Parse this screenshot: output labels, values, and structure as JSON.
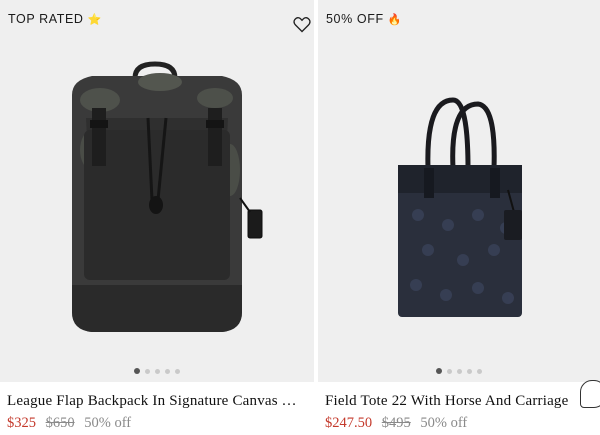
{
  "products": [
    {
      "badge": "TOP RATED",
      "badge_emoji": "⭐",
      "title": "League Flap Backpack In Signature Canvas Wi…",
      "price": "$325",
      "original_price": "$650",
      "discount": "50% off",
      "image_dots": 5,
      "active_dot": 0
    },
    {
      "badge": "50% OFF",
      "badge_emoji": "🔥",
      "title": "Field Tote 22 With Horse And Carriage",
      "price": "$247.50",
      "original_price": "$495",
      "discount": "50% off",
      "image_dots": 5,
      "active_dot": 0
    }
  ],
  "colors": {
    "sale_price": "#c43a2c",
    "image_background": "#efefef"
  },
  "icons": {
    "favorite": "heart-outline-icon",
    "chat": "chat-bubble-icon"
  }
}
